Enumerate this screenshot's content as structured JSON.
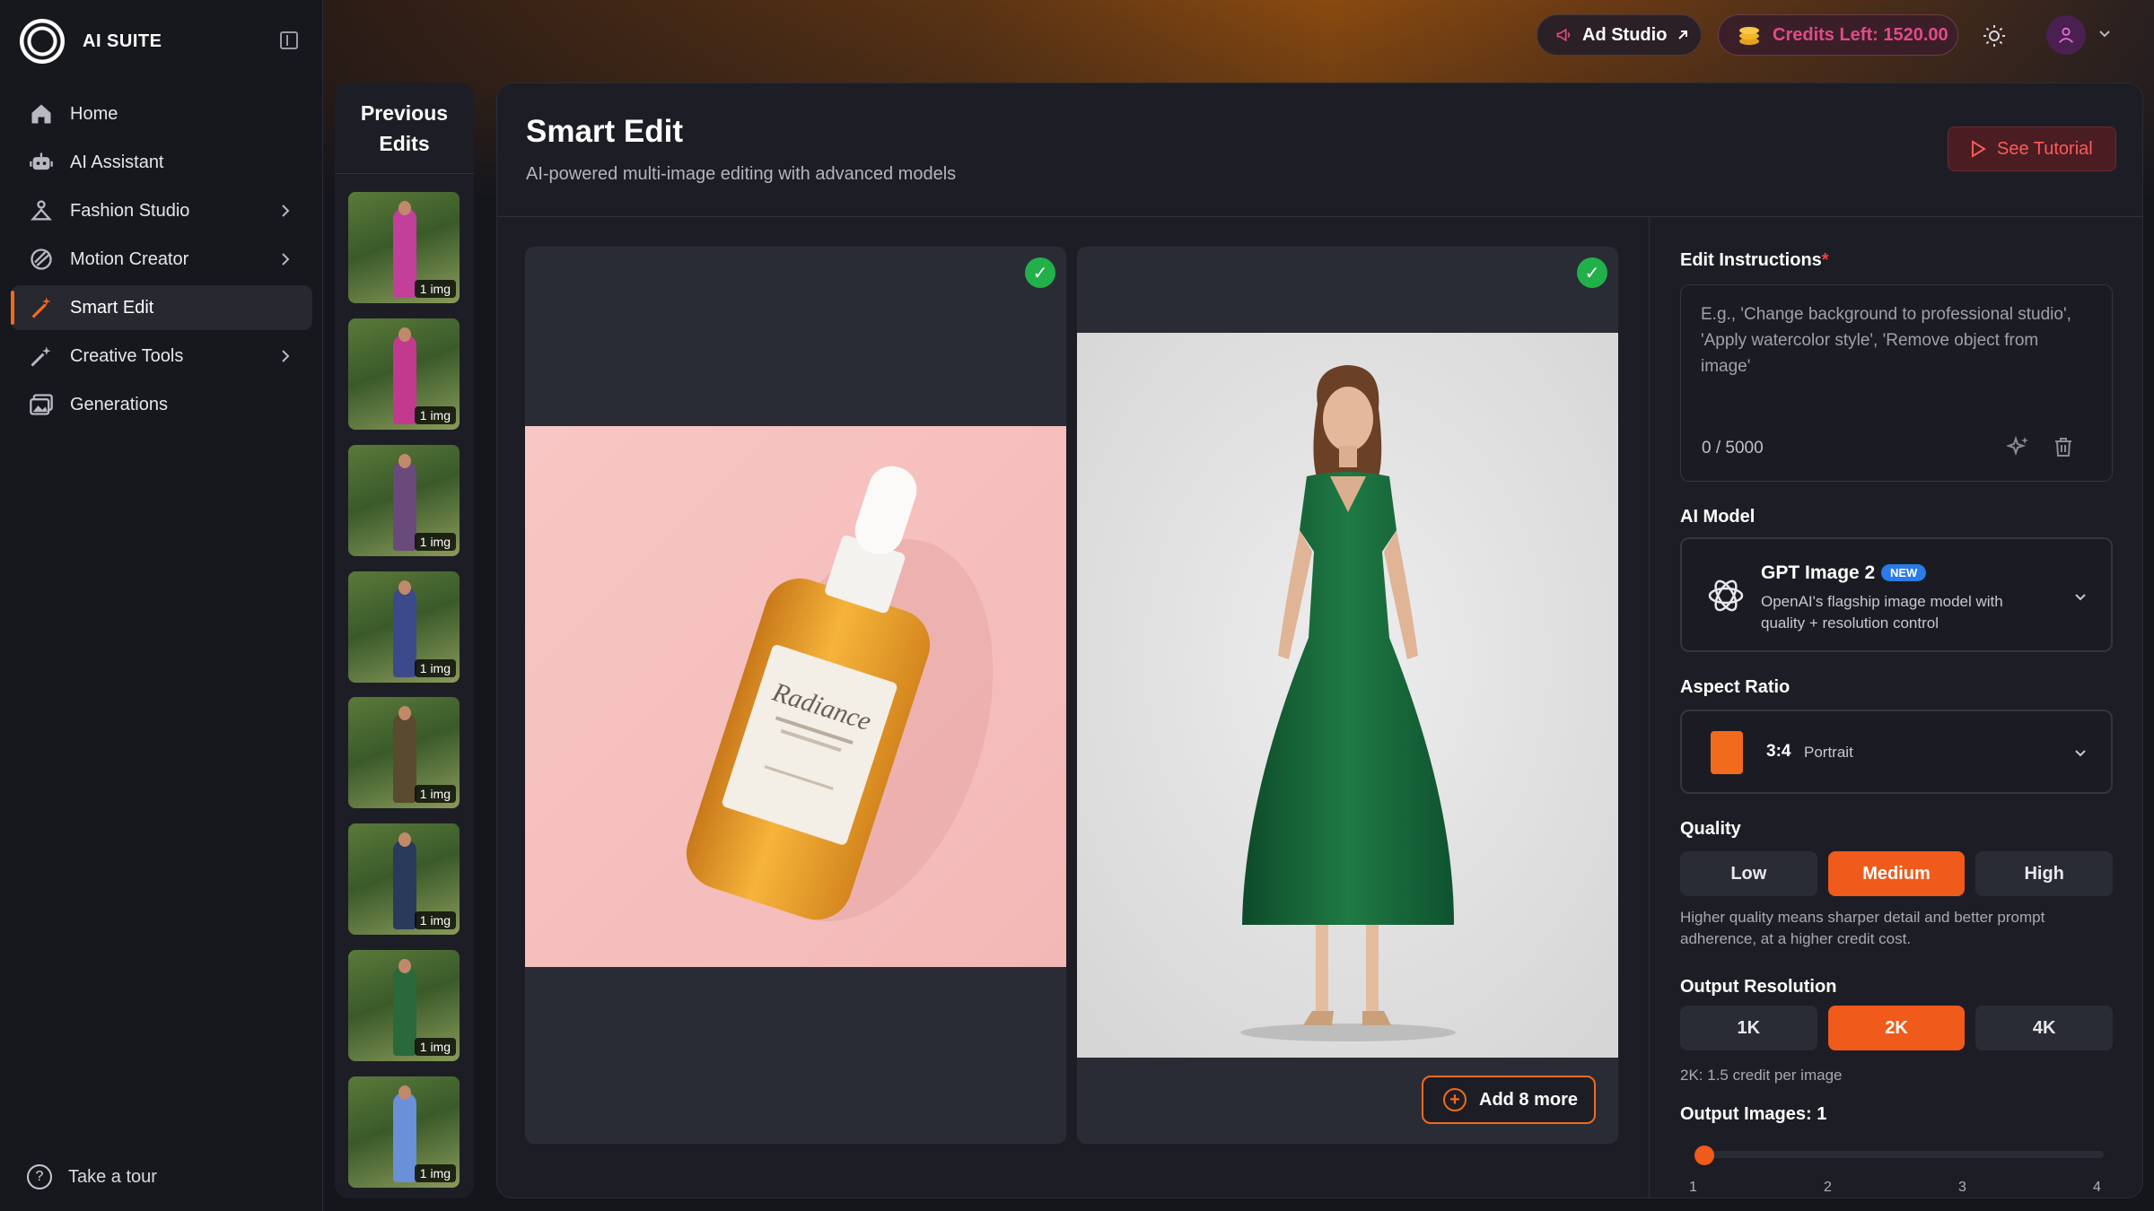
{
  "app": {
    "name": "AI SUITE"
  },
  "sidebar": {
    "items": [
      {
        "label": "Home",
        "icon": "home-icon",
        "chevron": false,
        "active": false
      },
      {
        "label": "AI Assistant",
        "icon": "robot-icon",
        "chevron": false,
        "active": false
      },
      {
        "label": "Fashion Studio",
        "icon": "hanger-icon",
        "chevron": true,
        "active": false
      },
      {
        "label": "Motion Creator",
        "icon": "motion-icon",
        "chevron": true,
        "active": false
      },
      {
        "label": "Smart Edit",
        "icon": "magic-wand-icon",
        "chevron": false,
        "active": true
      },
      {
        "label": "Creative Tools",
        "icon": "wand-sparkle-icon",
        "chevron": true,
        "active": false
      },
      {
        "label": "Generations",
        "icon": "gallery-icon",
        "chevron": false,
        "active": false
      }
    ],
    "tour_label": "Take a tour"
  },
  "header": {
    "ad_studio_label": "Ad Studio",
    "credits_label": "Credits Left: 1520.00"
  },
  "previous_edits": {
    "title_line1": "Previous",
    "title_line2": "Edits",
    "thumb_tag": "1 img",
    "thumbnails": [
      {
        "color": "#c2409a"
      },
      {
        "color": "#c23a8e"
      },
      {
        "color": "#6a4a7a"
      },
      {
        "color": "#3a4a8a"
      },
      {
        "color": "#5a4a30"
      },
      {
        "color": "#2a3a5a"
      },
      {
        "color": "#2a6a3a"
      },
      {
        "color": "#6a90d8"
      }
    ]
  },
  "main": {
    "title": "Smart Edit",
    "subtitle": "AI-powered multi-image editing with advanced models",
    "tutorial_label": "See Tutorial",
    "images": [
      {
        "caption": "Radiance"
      },
      {
        "caption": ""
      }
    ],
    "add_more_label": "Add 8 more"
  },
  "panel": {
    "edit_instructions_label": "Edit Instructions",
    "required_mark": "*",
    "edit_placeholder": "E.g., 'Change background to professional studio', 'Apply watercolor style', 'Remove object from image'",
    "char_counter": "0 / 5000",
    "ai_model_label": "AI Model",
    "model": {
      "name": "GPT Image 2",
      "badge": "NEW",
      "description": "OpenAI's flagship image model with quality + resolution control"
    },
    "aspect_ratio_label": "Aspect Ratio",
    "aspect_ratio": {
      "value": "3:4",
      "name": "Portrait"
    },
    "quality_label": "Quality",
    "quality_options": [
      "Low",
      "Medium",
      "High"
    ],
    "quality_selected": "Medium",
    "quality_hint": "Higher quality means sharper detail and better prompt adherence, at a higher credit cost.",
    "resolution_label": "Output Resolution",
    "resolution_options": [
      "1K",
      "2K",
      "4K"
    ],
    "resolution_selected": "2K",
    "resolution_hint": "2K: 1.5 credit per image",
    "output_images_label": "Output Images: 1",
    "output_images_value": 1,
    "slider_ticks": [
      "1",
      "2",
      "3",
      "4"
    ]
  },
  "colors": {
    "accent": "#f26a1b",
    "success": "#22b04a",
    "credits": "#e24a8a",
    "tutorial": "#ff5a5a",
    "badge": "#2a7ae8"
  }
}
